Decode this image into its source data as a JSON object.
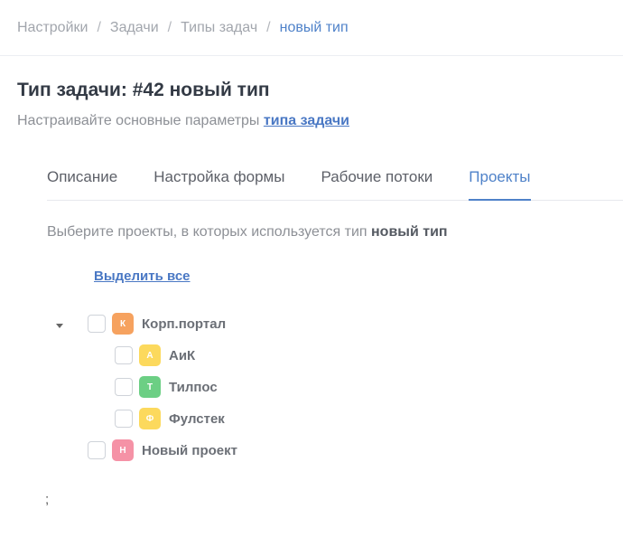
{
  "breadcrumbs": {
    "items": [
      "Настройки",
      "Задачи",
      "Типы задач"
    ],
    "current": "новый тип",
    "separator": "/"
  },
  "header": {
    "title": "Тип задачи: #42 новый тип",
    "subtitle_prefix": "Настраивайте основные параметры",
    "subtitle_link": "типа задачи"
  },
  "tabs": [
    {
      "label": "Описание",
      "active": false
    },
    {
      "label": "Настройка формы",
      "active": false
    },
    {
      "label": "Рабочие потоки",
      "active": false
    },
    {
      "label": "Проекты",
      "active": true
    }
  ],
  "projects_tab": {
    "hint_prefix": "Выберите проекты, в которых используется тип",
    "hint_bold": "новый тип",
    "select_all": "Выделить все",
    "tree": [
      {
        "name": "Корп.портал",
        "letter": "К",
        "color": "#f6a25f",
        "checked": false,
        "expanded": true,
        "children": [
          {
            "name": "АиК",
            "letter": "А",
            "color": "#fcd95d",
            "checked": false
          },
          {
            "name": "Тилпос",
            "letter": "Т",
            "color": "#6ccf84",
            "checked": false
          },
          {
            "name": "Фулстек",
            "letter": "Ф",
            "color": "#fcd95d",
            "checked": false
          }
        ]
      },
      {
        "name": "Новый проект",
        "letter": "Н",
        "color": "#f592a6",
        "checked": false,
        "expanded": false
      }
    ]
  },
  "footer_text": ";",
  "colors": {
    "accent": "#4f82c9",
    "muted_text": "#8d9096",
    "border": "#e7e9ed"
  }
}
